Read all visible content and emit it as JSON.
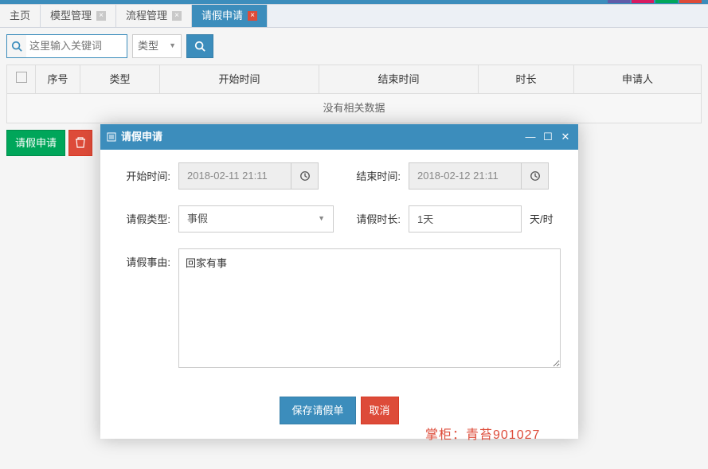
{
  "tabs": [
    {
      "label": "主页",
      "closable": false
    },
    {
      "label": "模型管理",
      "closable": true
    },
    {
      "label": "流程管理",
      "closable": true
    },
    {
      "label": "请假申请",
      "closable": true,
      "active": true
    }
  ],
  "toolbar": {
    "search_placeholder": "这里输入关键词",
    "type_label": "类型"
  },
  "table": {
    "headers": {
      "seq": "序号",
      "type": "类型",
      "start": "开始时间",
      "end": "结束时间",
      "duration": "时长",
      "applicant": "申请人"
    },
    "empty": "没有相关数据"
  },
  "actions": {
    "apply": "请假申请"
  },
  "dialog": {
    "title": "请假申请",
    "start_label": "开始时间:",
    "end_label": "结束时间:",
    "type_label": "请假类型:",
    "duration_label": "请假时长:",
    "reason_label": "请假事由:",
    "unit": "天/时",
    "start_value": "2018-02-11 21:11",
    "end_value": "2018-02-12 21:11",
    "type_value": "事假",
    "duration_value": "1天",
    "reason_value": "回家有事",
    "save": "保存请假单",
    "cancel": "取消"
  },
  "watermark": "掌柜：青苔901027"
}
